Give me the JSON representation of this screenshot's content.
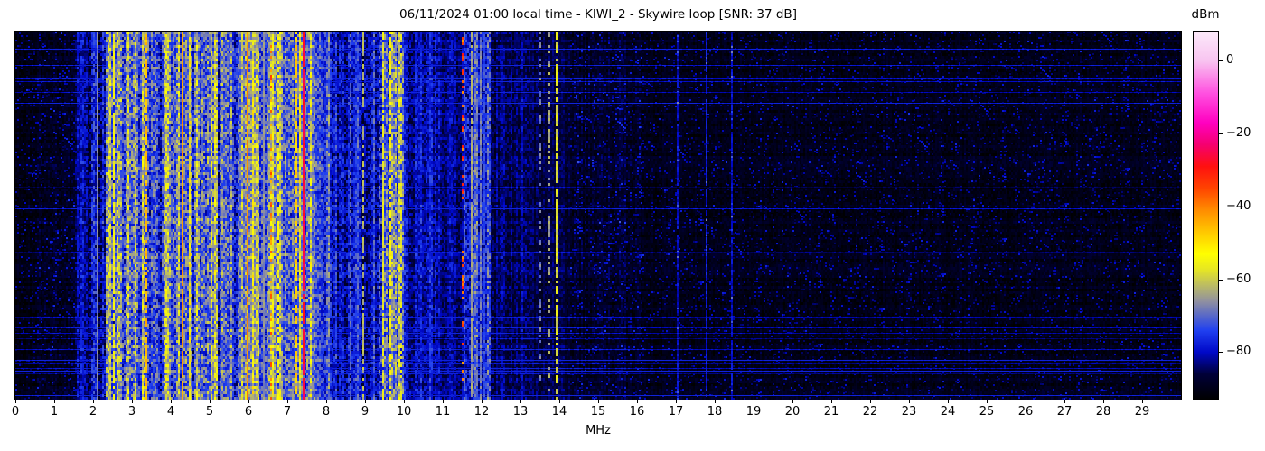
{
  "title": "06/11/2024 01:00 local time - KIWI_2 - Skywire loop [SNR: 37 dB]",
  "chart_data": {
    "type": "heatmap",
    "subtype": "radio-spectrum-waterfall",
    "title": "06/11/2024 01:00 local time - KIWI_2 - Skywire loop [SNR: 37 dB]",
    "xlabel": "MHz",
    "xlim": [
      0,
      30
    ],
    "x_ticks": [
      0,
      1,
      2,
      3,
      4,
      5,
      6,
      7,
      8,
      9,
      10,
      11,
      12,
      13,
      14,
      15,
      16,
      17,
      18,
      19,
      20,
      21,
      22,
      23,
      24,
      25,
      26,
      27,
      28,
      29
    ],
    "colorbar": {
      "label": "dBm",
      "vmin": -93,
      "vmax": 8,
      "ticks": [
        {
          "v": 0,
          "label": "0"
        },
        {
          "v": -20,
          "label": "−20"
        },
        {
          "v": -40,
          "label": "−40"
        },
        {
          "v": -60,
          "label": "−60"
        },
        {
          "v": -80,
          "label": "−80"
        }
      ]
    },
    "colormap_stops": [
      [
        0.0,
        "#000000"
      ],
      [
        0.069,
        "#000038"
      ],
      [
        0.129,
        "#0008c8"
      ],
      [
        0.188,
        "#2040f0"
      ],
      [
        0.228,
        "#5868c8"
      ],
      [
        0.267,
        "#9090a0"
      ],
      [
        0.307,
        "#b8b868"
      ],
      [
        0.356,
        "#e8e820"
      ],
      [
        0.396,
        "#ffff00"
      ],
      [
        0.455,
        "#ffc800"
      ],
      [
        0.515,
        "#ff8c00"
      ],
      [
        0.574,
        "#ff4400"
      ],
      [
        0.634,
        "#ff1010"
      ],
      [
        0.693,
        "#f50070"
      ],
      [
        0.752,
        "#ff00c0"
      ],
      [
        0.832,
        "#ff50e0"
      ],
      [
        0.921,
        "#f8c4f0"
      ],
      [
        1.0,
        "#fceafa"
      ]
    ],
    "bands": [
      [
        0.0,
        0.55,
        -91,
        2,
        1
      ],
      [
        0.55,
        1.55,
        -89,
        3,
        1
      ],
      [
        1.55,
        1.9,
        -83,
        5,
        4
      ],
      [
        1.9,
        2.32,
        -79,
        7,
        6
      ],
      [
        2.32,
        3.45,
        -68,
        9,
        9
      ],
      [
        3.45,
        3.8,
        -75,
        8,
        7
      ],
      [
        3.8,
        4.5,
        -65,
        9,
        9
      ],
      [
        4.5,
        5.2,
        -68,
        9,
        9
      ],
      [
        5.2,
        5.75,
        -73,
        8,
        8
      ],
      [
        5.75,
        6.25,
        -63,
        8,
        8
      ],
      [
        6.25,
        7.05,
        -67,
        8,
        8
      ],
      [
        7.05,
        7.62,
        -64,
        9,
        9
      ],
      [
        7.62,
        8.2,
        -75,
        7,
        7
      ],
      [
        8.2,
        9.35,
        -79,
        6,
        7
      ],
      [
        9.35,
        10.0,
        -70,
        9,
        9
      ],
      [
        10.0,
        10.95,
        -80,
        5,
        4
      ],
      [
        10.95,
        11.55,
        -82,
        4,
        3
      ],
      [
        11.55,
        12.25,
        -75,
        7,
        6
      ],
      [
        12.25,
        13.2,
        -84,
        4,
        3
      ],
      [
        13.2,
        14.3,
        -86,
        3,
        2
      ],
      [
        14.3,
        16.2,
        -88,
        3,
        2
      ],
      [
        16.2,
        30.01,
        -90,
        2,
        1
      ]
    ],
    "vertical_lines": [
      [
        2.07,
        -67,
        1,
        1.0
      ],
      [
        2.5,
        -55,
        2,
        0.8
      ],
      [
        3.33,
        -46,
        2,
        0.65
      ],
      [
        4.3,
        -43,
        2,
        0.95
      ],
      [
        5.95,
        -41,
        2,
        0.9
      ],
      [
        6.35,
        -66,
        1,
        1.0
      ],
      [
        6.75,
        -55,
        2,
        0.6
      ],
      [
        7.2,
        -48,
        2,
        0.7
      ],
      [
        7.38,
        -26,
        2,
        0.97
      ],
      [
        8.6,
        -70,
        1,
        0.7
      ],
      [
        8.95,
        -62,
        1,
        0.6
      ],
      [
        9.45,
        -57,
        2,
        0.8
      ],
      [
        9.65,
        -52,
        2,
        0.7
      ],
      [
        9.9,
        -58,
        2,
        0.7
      ],
      [
        11.72,
        -64,
        1,
        0.9
      ],
      [
        11.95,
        -68,
        1,
        0.8
      ],
      [
        12.05,
        -73,
        2,
        0.9
      ],
      [
        13.5,
        -68,
        1,
        0.4
      ],
      [
        13.7,
        -64,
        1,
        0.45
      ],
      [
        13.93,
        -58,
        1,
        0.75
      ],
      [
        17.0,
        -80,
        1,
        0.9
      ],
      [
        17.78,
        -78,
        1,
        0.9
      ],
      [
        18.42,
        -80,
        1,
        0.9
      ]
    ],
    "dotted_lines": [
      [
        6.55,
        -40,
        0.4,
        6
      ],
      [
        11.49,
        -35,
        0.3,
        8
      ]
    ],
    "noise": {
      "speckle_probability": 0.13,
      "speckle_gain": [
        4,
        7
      ],
      "row_event_probability": 0.15,
      "row_event_gain": [
        5,
        9
      ]
    }
  }
}
